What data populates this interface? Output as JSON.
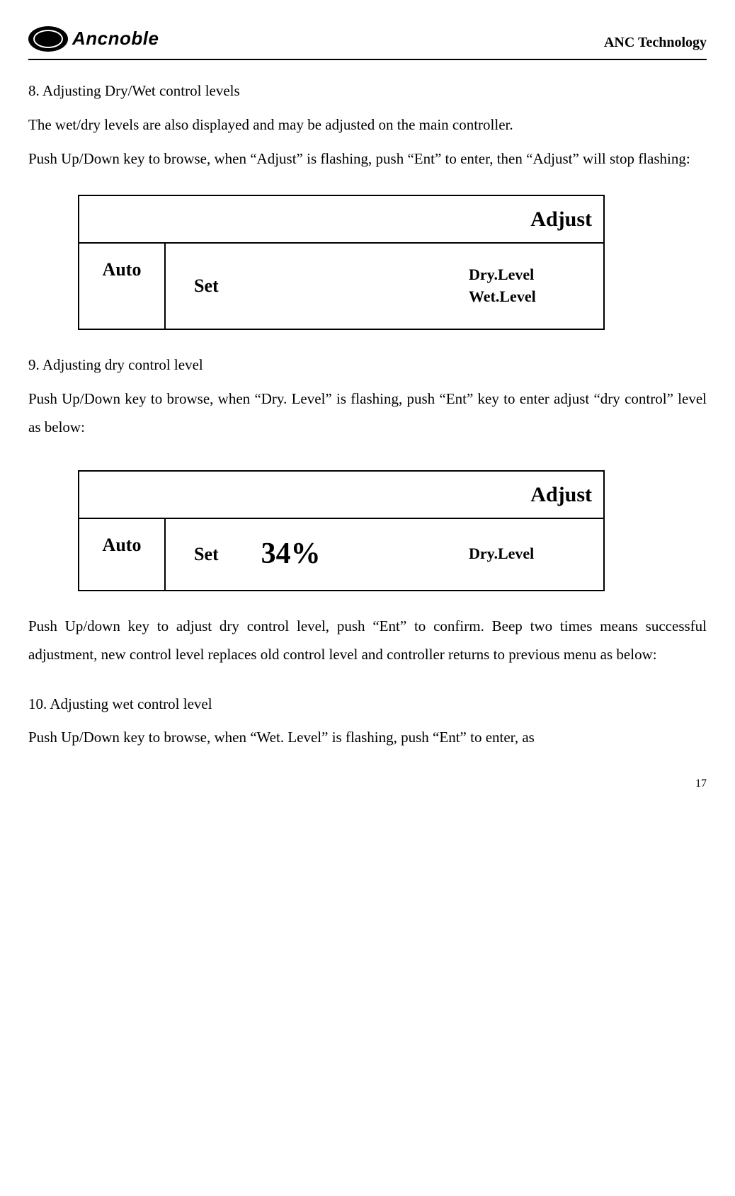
{
  "header": {
    "logo_text": "Ancnoble",
    "right_text": "ANC Technology"
  },
  "section8": {
    "heading": "8. Adjusting Dry/Wet control levels",
    "para1": "The wet/dry levels are also displayed and may be adjusted on the main controller.",
    "para2": "Push Up/Down key to browse, when “Adjust” is flashing, push “Ent” to enter, then “Adjust” will stop flashing:"
  },
  "lcd1": {
    "top": "Adjust",
    "col1": "Auto",
    "col2_set": "Set",
    "col3_dry": "Dry.Level",
    "col3_wet": "Wet.Level"
  },
  "section9": {
    "heading": "9.  Adjusting dry control level",
    "para1": "Push Up/Down key to browse, when “Dry. Level” is flashing, push “Ent” key to enter adjust “dry control” level as below:"
  },
  "lcd2": {
    "top": "Adjust",
    "col1": "Auto",
    "col2_set": "Set",
    "col2_value": "34%",
    "col3_dry": "Dry.Level"
  },
  "section9b": {
    "para1": "Push Up/down key to adjust dry control level, push “Ent” to confirm. Beep two times means successful adjustment, new control level replaces old control level and controller returns to previous menu as below:"
  },
  "section10": {
    "heading": "10. Adjusting wet control level",
    "para1": "Push Up/Down key to browse, when “Wet. Level” is flashing, push “Ent” to enter, as"
  },
  "page_number": "17"
}
